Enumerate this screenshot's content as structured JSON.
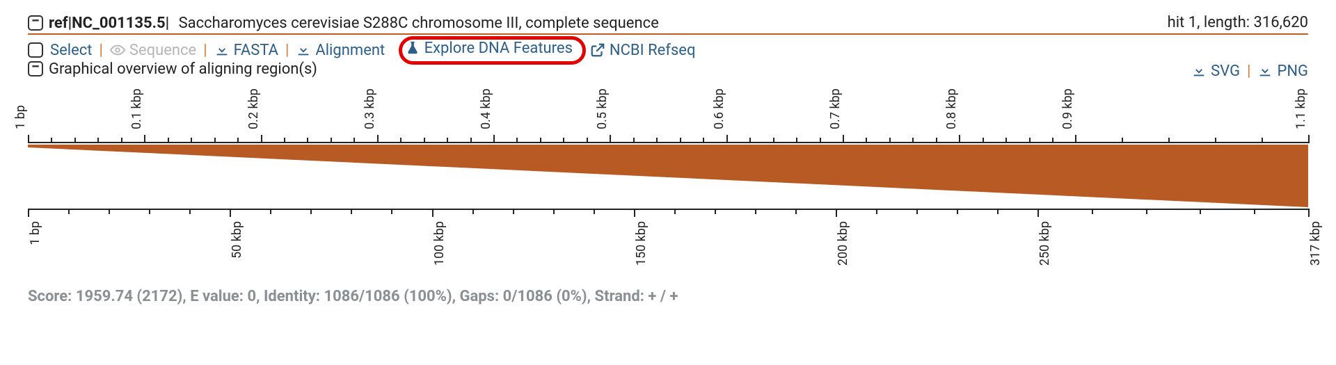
{
  "header": {
    "ref": "ref|NC_001135.5|",
    "desc": "Saccharomyces cerevisiae S288C chromosome III, complete sequence",
    "hit": "hit 1, length: 316,620"
  },
  "toolbar": {
    "select": "Select",
    "sequence": "Sequence",
    "fasta": "FASTA",
    "alignment": "Alignment",
    "explore": "Explore DNA Features",
    "ncbi": "NCBI Refseq"
  },
  "overview": "Graphical overview of aligning region(s)",
  "export": {
    "svg": "SVG",
    "png": "PNG"
  },
  "stats": "Score: 1959.74 (2172), E value: 0, Identity: 1086/1086 (100%), Gaps: 0/1086 (0%), Strand: + / +",
  "chart_data": {
    "type": "area",
    "top_axis": {
      "unit": "kbp",
      "ticks": [
        "1 bp",
        "0.1 kbp",
        "0.2 kbp",
        "0.3 kbp",
        "0.4 kbp",
        "0.5 kbp",
        "0.6 kbp",
        "0.7 kbp",
        "0.8 kbp",
        "0.9 kbp",
        "1.1 kbp"
      ],
      "positions_pct": [
        0,
        9.09,
        18.18,
        27.27,
        36.36,
        45.45,
        54.55,
        63.64,
        72.73,
        81.82,
        100
      ],
      "range": [
        1,
        1100
      ]
    },
    "bottom_axis": {
      "unit": "kbp",
      "ticks": [
        "1 bp",
        "50 kbp",
        "100 kbp",
        "150 kbp",
        "200 kbp",
        "250 kbp",
        "317 kbp"
      ],
      "positions_pct": [
        0,
        15.77,
        31.55,
        47.32,
        63.09,
        78.86,
        100
      ],
      "range": [
        1,
        317000
      ]
    },
    "align_polygon": {
      "comment": "Wedge mapping query region (top ruler) to subject region (bottom ruler)",
      "top_left_pct": 0,
      "top_right_pct": 100,
      "bottom_left_pct": 100,
      "bottom_right_pct": 100,
      "top_thickness_px": 4,
      "bottom_thickness_px": 4
    },
    "color": "#b85a24"
  }
}
